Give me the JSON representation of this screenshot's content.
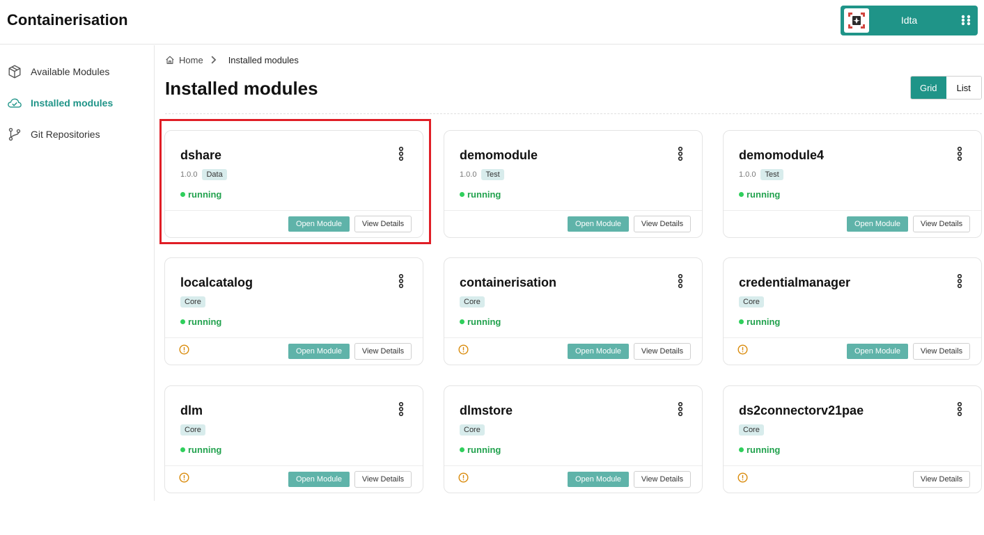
{
  "app": {
    "title": "Containerisation"
  },
  "user": {
    "name": "Idta"
  },
  "sidebar": {
    "items": [
      {
        "label": "Available Modules",
        "icon": "package-icon"
      },
      {
        "label": "Installed modules",
        "icon": "cloud-check-icon",
        "active": true
      },
      {
        "label": "Git Repositories",
        "icon": "git-branch-icon"
      }
    ]
  },
  "breadcrumb": {
    "home": "Home",
    "current": "Installed modules"
  },
  "page": {
    "title": "Installed modules"
  },
  "view_toggle": {
    "grid": "Grid",
    "list": "List",
    "selected": "Grid"
  },
  "buttons": {
    "open": "Open Module",
    "details": "View Details"
  },
  "colors": {
    "accent": "#1f9488",
    "running": "#22a24e",
    "warning": "#d98a0a",
    "highlight": "#e01e26"
  },
  "modules": [
    {
      "name": "dshare",
      "version": "1.0.0",
      "tag": "Data",
      "status": "running",
      "warning": false,
      "open": true
    },
    {
      "name": "demomodule",
      "version": "1.0.0",
      "tag": "Test",
      "status": "running",
      "warning": false,
      "open": true
    },
    {
      "name": "demomodule4",
      "version": "1.0.0",
      "tag": "Test",
      "status": "running",
      "warning": false,
      "open": true
    },
    {
      "name": "localcatalog",
      "version": "",
      "tag": "Core",
      "status": "running",
      "warning": true,
      "open": true
    },
    {
      "name": "containerisation",
      "version": "",
      "tag": "Core",
      "status": "running",
      "warning": true,
      "open": true
    },
    {
      "name": "credentialmanager",
      "version": "",
      "tag": "Core",
      "status": "running",
      "warning": true,
      "open": true
    },
    {
      "name": "dlm",
      "version": "",
      "tag": "Core",
      "status": "running",
      "warning": true,
      "open": true
    },
    {
      "name": "dlmstore",
      "version": "",
      "tag": "Core",
      "status": "running",
      "warning": true,
      "open": true
    },
    {
      "name": "ds2connectorv21pae",
      "version": "",
      "tag": "Core",
      "status": "running",
      "warning": true,
      "open": false
    }
  ]
}
